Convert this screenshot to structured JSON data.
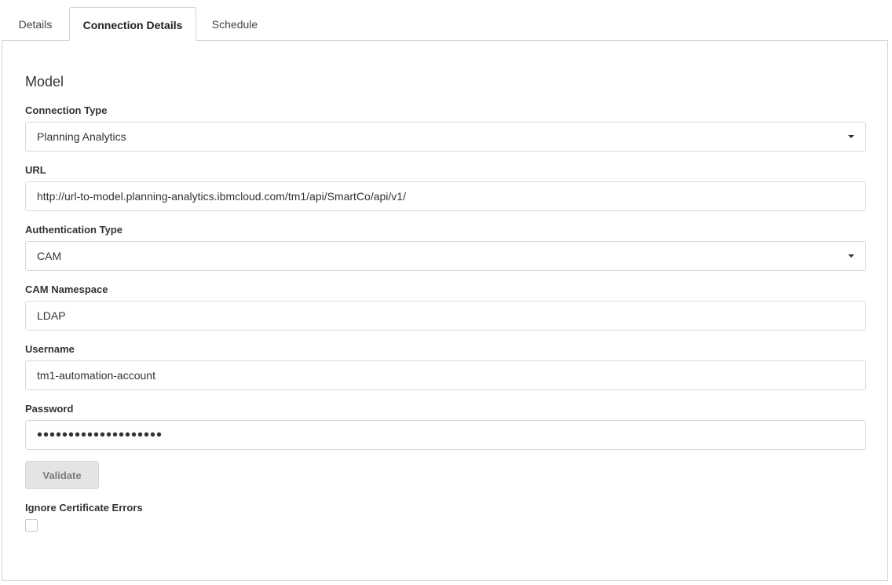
{
  "tabs": [
    {
      "label": "Details"
    },
    {
      "label": "Connection Details"
    },
    {
      "label": "Schedule"
    }
  ],
  "active_tab": "Connection Details",
  "section": {
    "title": "Model"
  },
  "fields": {
    "connection_type": {
      "label": "Connection Type",
      "value": "Planning Analytics"
    },
    "url": {
      "label": "URL",
      "value": "http://url-to-model.planning-analytics.ibmcloud.com/tm1/api/SmartCo/api/v1/"
    },
    "auth_type": {
      "label": "Authentication Type",
      "value": "CAM"
    },
    "cam_namespace": {
      "label": "CAM Namespace",
      "value": "LDAP"
    },
    "username": {
      "label": "Username",
      "value": "tm1-automation-account"
    },
    "password": {
      "label": "Password",
      "masked_value": "••••••••••••••••••••"
    }
  },
  "validate_button": {
    "label": "Validate"
  },
  "ignore_cert": {
    "label": "Ignore Certificate Errors",
    "checked": false
  },
  "icons": {
    "dropdown": "chevron-down-icon"
  }
}
